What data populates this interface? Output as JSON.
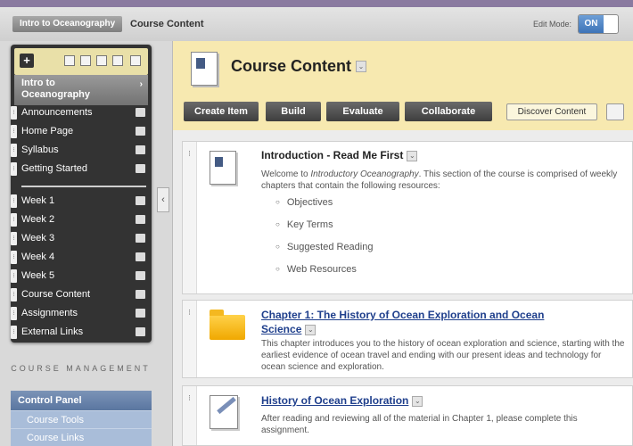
{
  "topbar": {
    "crumb_course": "Intro to Oceanography",
    "crumb_page": "Course Content",
    "edit_mode_label": "Edit Mode:",
    "edit_mode_value": "ON"
  },
  "course_menu": {
    "title_line1": "Intro to",
    "title_line2": "Oceanography",
    "items": [
      {
        "label": "Announcements"
      },
      {
        "label": "Home Page"
      },
      {
        "label": "Syllabus"
      },
      {
        "label": "Getting Started"
      },
      {
        "label": "Week 1"
      },
      {
        "label": "Week 2"
      },
      {
        "label": "Week 3"
      },
      {
        "label": "Week 4"
      },
      {
        "label": "Week 5"
      },
      {
        "label": "Course Content"
      },
      {
        "label": "Assignments"
      },
      {
        "label": "External Links"
      }
    ]
  },
  "course_management": {
    "header": "COURSE MANAGEMENT",
    "control_panel": "Control Panel",
    "items": [
      "Course Tools",
      "Course Links"
    ]
  },
  "content": {
    "title": "Course Content",
    "actions": [
      "Create Item",
      "Build",
      "Evaluate",
      "Collaborate"
    ],
    "discover": "Discover Content",
    "items": [
      {
        "title": "Introduction - Read Me First",
        "desc_pre": "Welcome to ",
        "desc_em": "Introductory Oceanography",
        "desc_post": ". This section of the course is comprised of weekly chapters that contain the following resources:",
        "bullets": [
          "Objectives",
          "Key Terms",
          "Suggested Reading",
          "Web Resources"
        ]
      },
      {
        "title_line1": "Chapter 1: The History of Ocean Exploration and Ocean",
        "title_line2": "Science",
        "desc": "This chapter introduces you to the history of ocean exploration and science, starting with the earliest evidence of ocean travel and ending with our present ideas and technology for ocean science and exploration."
      },
      {
        "title": "History of Ocean Exploration",
        "desc": "After reading and reviewing all of the material in Chapter 1, please complete this assignment."
      }
    ]
  },
  "icons": {
    "add": "plus-icon",
    "collapse": "chevron-left-icon",
    "dropdown": "double-chevron-down-icon"
  },
  "colors": {
    "header_bg": "#f7e9b0",
    "menu_bg": "#333333",
    "control_panel": "#5a76a0",
    "link": "#1f3f8c"
  }
}
